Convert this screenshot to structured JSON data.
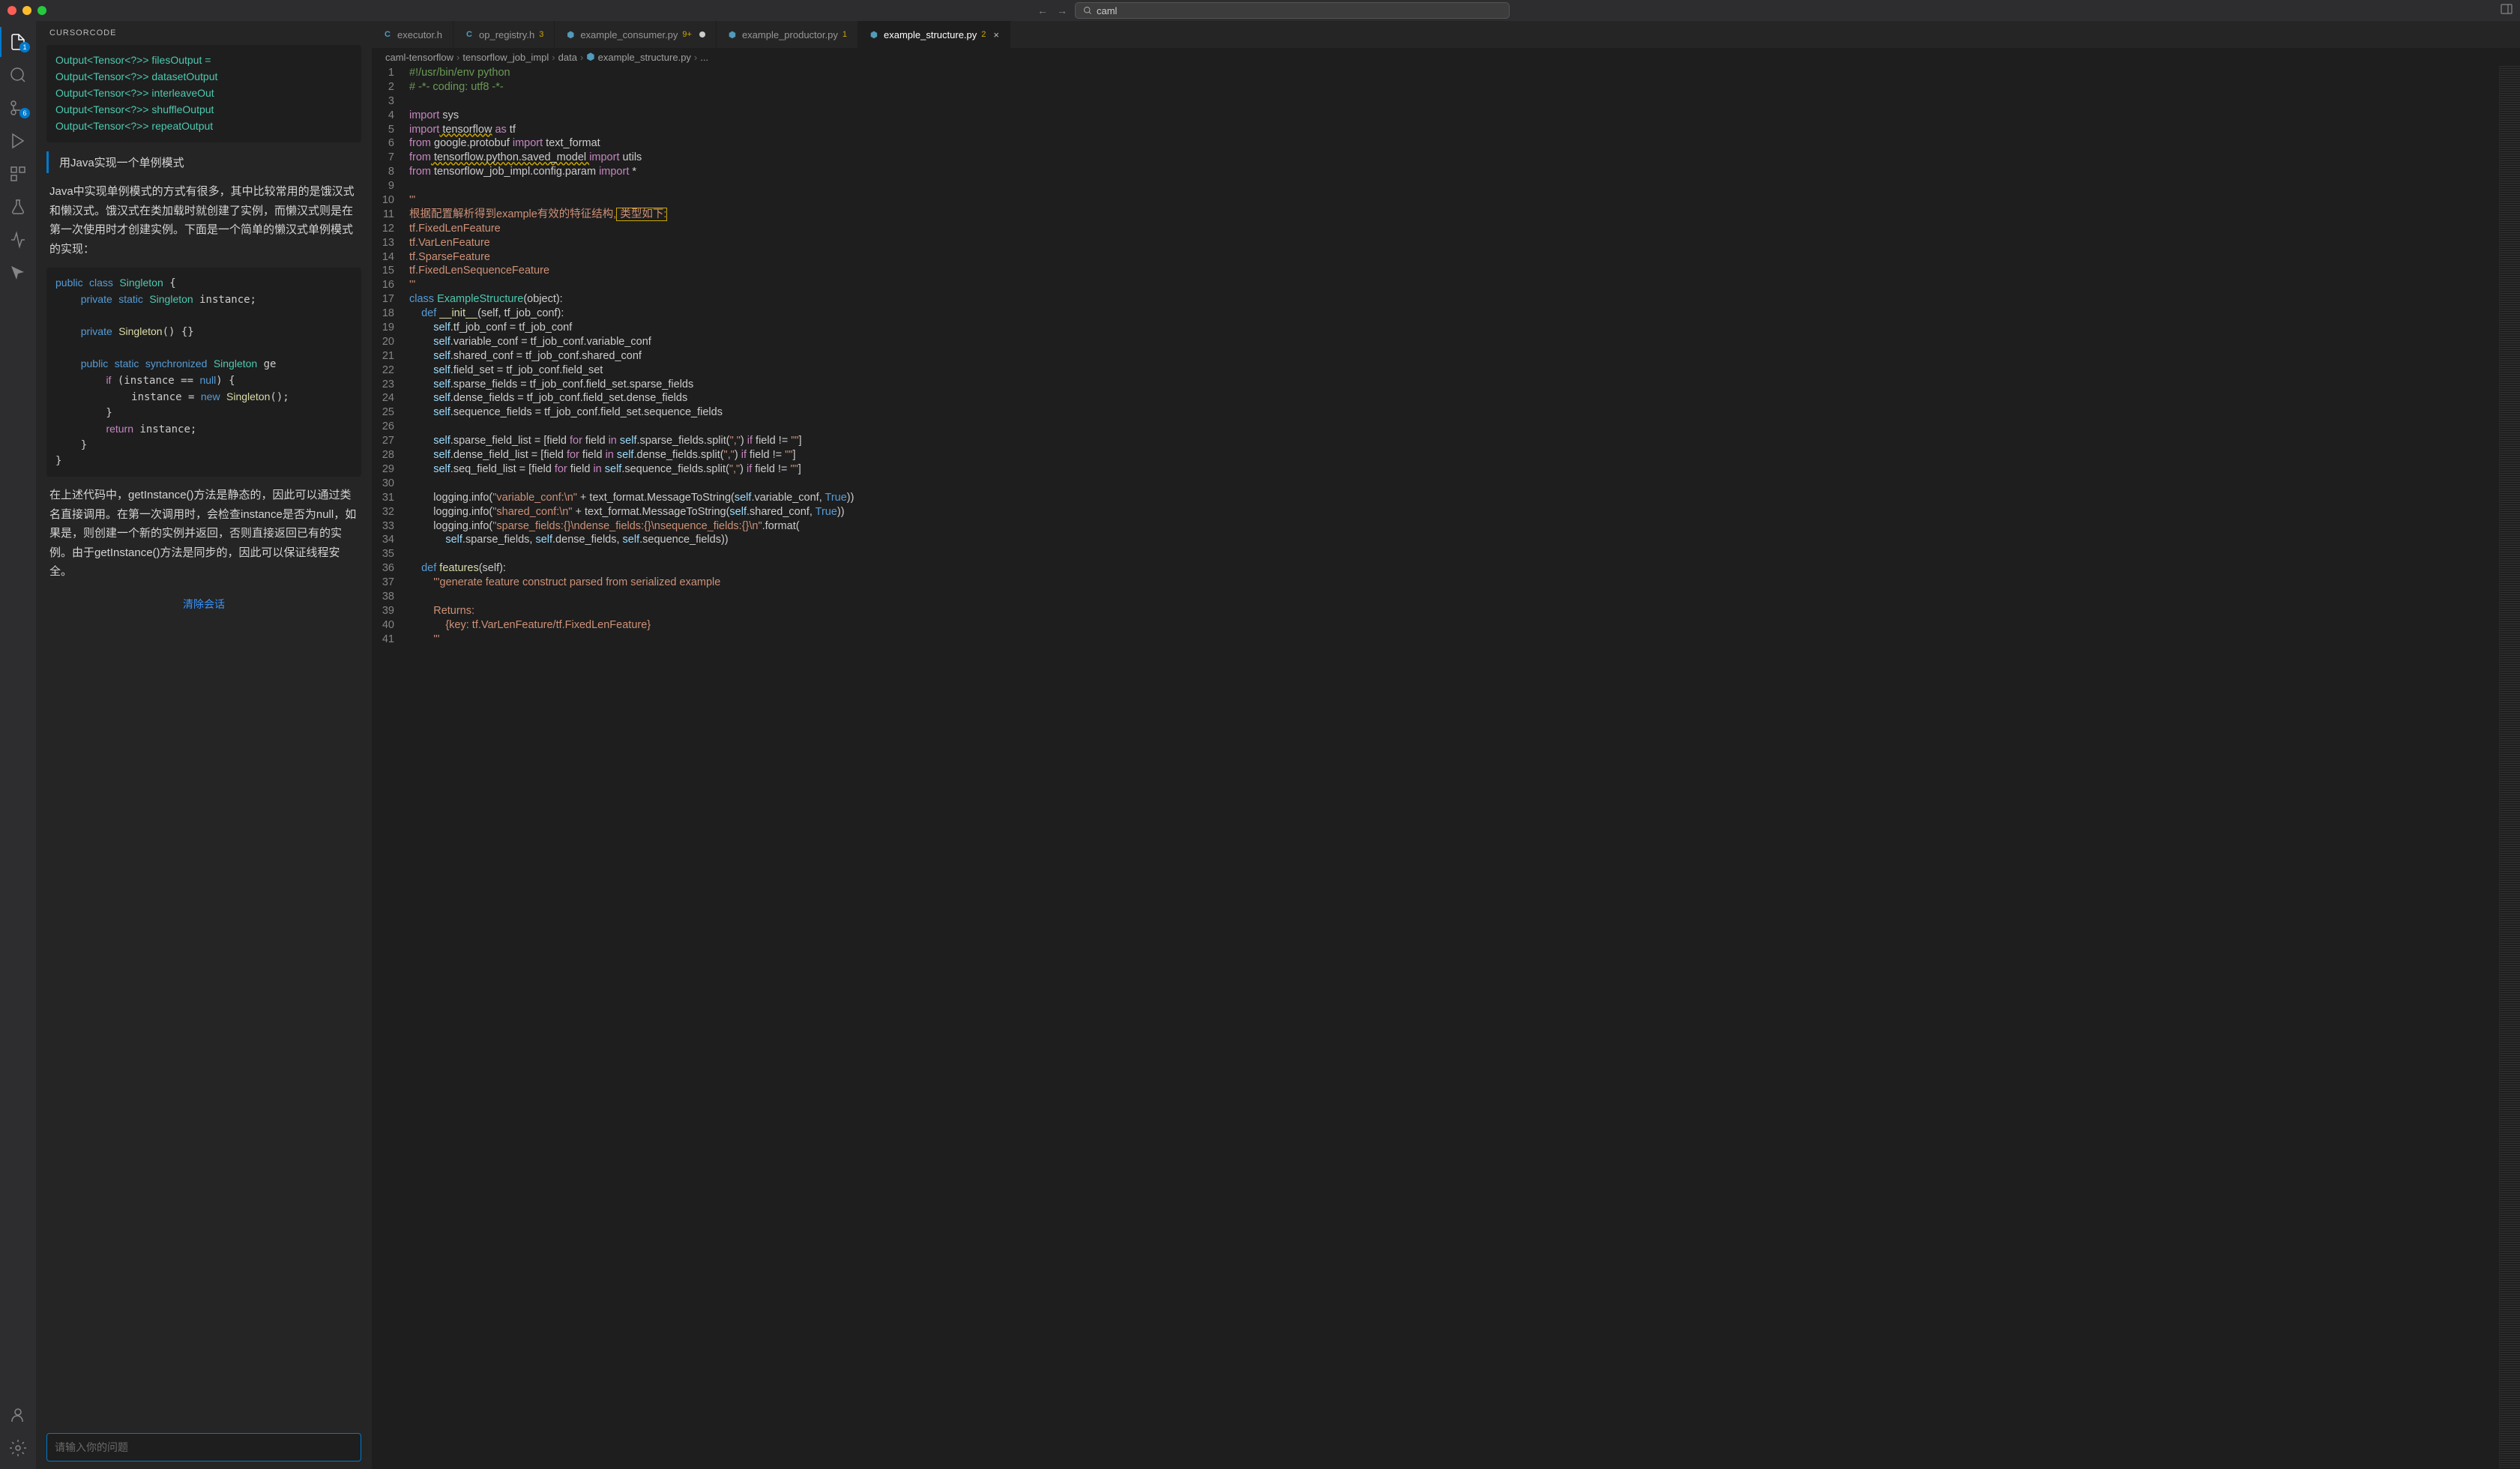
{
  "search": {
    "text": "caml"
  },
  "sidebar": {
    "header": "CURSORCODE",
    "badges": {
      "explorer": "1",
      "scm": "6"
    },
    "code1": "Output<Tensor<?>> filesOutput =\nOutput<Tensor<?>> datasetOutput\nOutput<Tensor<?>> interleaveOut\nOutput<Tensor<?>> shuffleOutput\nOutput<Tensor<?>> repeatOutput",
    "user_msg": "用Java实现一个单例模式",
    "reply1": "Java中实现单例模式的方式有很多，其中比较常用的是饿汉式和懒汉式。饿汉式在类加载时就创建了实例，而懒汉式则是在第一次使用时才创建实例。下面是一个简单的懒汉式单例模式的实现：",
    "reply2": "在上述代码中，getInstance()方法是静态的，因此可以通过类名直接调用。在第一次调用时，会检查instance是否为null，如果是，则创建一个新的实例并返回，否则直接返回已有的实例。由于getInstance()方法是同步的，因此可以保证线程安全。",
    "clear": "清除会话",
    "input_placeholder": "请输入你的问题"
  },
  "tabs": [
    {
      "icon": "C",
      "label": "executor.h",
      "badge": "",
      "active": false,
      "modified": false
    },
    {
      "icon": "C",
      "label": "op_registry.h",
      "badge": "3",
      "active": false,
      "modified": false
    },
    {
      "icon": "py",
      "label": "example_consumer.py",
      "badge": "9+",
      "active": false,
      "modified": true
    },
    {
      "icon": "py",
      "label": "example_productor.py",
      "badge": "1",
      "active": false,
      "modified": false
    },
    {
      "icon": "py",
      "label": "example_structure.py",
      "badge": "2",
      "active": true,
      "modified": false
    }
  ],
  "breadcrumb": [
    "caml-tensorflow",
    "tensorflow_job_impl",
    "data",
    "example_structure.py",
    "..."
  ],
  "java_code": {
    "l1": "public class Singleton {",
    "l2": "    private static Singleton instance;",
    "l3": "",
    "l4": "    private Singleton() {}",
    "l5": "",
    "l6": "    public static synchronized Singleton ge",
    "l7": "        if (instance == null) {",
    "l8": "            instance = new Singleton();",
    "l9": "        }",
    "l10": "        return instance;",
    "l11": "    }",
    "l12": "}"
  },
  "code": {
    "l1_a": "#!/usr/bin/env python",
    "l2_a": "# -*- coding: utf8 -*-",
    "l4_import": "import",
    "l4_sys": " sys",
    "l5_import": "import",
    "l5_tf": " tensorflow",
    "l5_as": " as",
    "l5_tfalias": " tf",
    "l6_from": "from",
    "l6_mod": " google.protobuf ",
    "l6_import": "import",
    "l6_name": " text_format",
    "l7_from": "from",
    "l7_mod": " tensorflow.python.saved_model ",
    "l7_import": "import",
    "l7_name": " utils",
    "l8_from": "from",
    "l8_mod": " tensorflow_job_impl.config.param ",
    "l8_import": "import",
    "l8_name": " *",
    "l10": "'''",
    "l11_a": "根据配置解析得到example有效的特征结构,",
    "l11_b": " 类型如下:",
    "l12": "tf.FixedLenFeature",
    "l13": "tf.VarLenFeature",
    "l14": "tf.SparseFeature",
    "l15": "tf.FixedLenSequenceFeature",
    "l16": "'''",
    "l17_class": "class",
    "l17_name": " ExampleStructure",
    "l17_rest": "(object):",
    "l18_def": "    def",
    "l18_name": " __init__",
    "l18_rest": "(self, tf_job_conf):",
    "l19_a": "        self",
    "l19_b": ".tf_job_conf = tf_job_conf",
    "l20_a": "        self",
    "l20_b": ".variable_conf = tf_job_conf.variable_conf",
    "l21_a": "        self",
    "l21_b": ".shared_conf = tf_job_conf.shared_conf",
    "l22_a": "        self",
    "l22_b": ".field_set = tf_job_conf.field_set",
    "l23_a": "        self",
    "l23_b": ".sparse_fields = tf_job_conf.field_set.sparse_fields",
    "l24_a": "        self",
    "l24_b": ".dense_fields = tf_job_conf.field_set.dense_fields",
    "l25_a": "        self",
    "l25_b": ".sequence_fields = tf_job_conf.field_set.sequence_fields",
    "l27_a": "        self",
    "l27_b": ".sparse_field_list = [field ",
    "l27_for": "for",
    "l27_c": " field ",
    "l27_in": "in",
    "l27_d": " self",
    "l27_e": ".sparse_fields.split(",
    "l27_str": "\",\"",
    "l27_f": ") ",
    "l27_if": "if",
    "l27_g": " field != ",
    "l27_str2": "\"\"",
    "l27_h": "]",
    "l28_a": "        self",
    "l28_b": ".dense_field_list = [field ",
    "l28_for": "for",
    "l28_c": " field ",
    "l28_in": "in",
    "l28_d": " self",
    "l28_e": ".dense_fields.split(",
    "l28_str": "\",\"",
    "l28_f": ") ",
    "l28_if": "if",
    "l28_g": " field != ",
    "l28_str2": "\"\"",
    "l28_h": "]",
    "l29_a": "        self",
    "l29_b": ".seq_field_list = [field ",
    "l29_for": "for",
    "l29_c": " field ",
    "l29_in": "in",
    "l29_d": " self",
    "l29_e": ".sequence_fields.split(",
    "l29_str": "\",\"",
    "l29_f": ") ",
    "l29_if": "if",
    "l29_g": " field != ",
    "l29_str2": "\"\"",
    "l29_h": "]",
    "l31_a": "        logging.info(",
    "l31_str": "\"variable_conf:\\n\"",
    "l31_b": " + text_format.MessageToString(",
    "l31_self": "self",
    "l31_c": ".variable_conf, ",
    "l31_true": "True",
    "l31_d": "))",
    "l32_a": "        logging.info(",
    "l32_str": "\"shared_conf:\\n\"",
    "l32_b": " + text_format.MessageToString(",
    "l32_self": "self",
    "l32_c": ".shared_conf, ",
    "l32_true": "True",
    "l32_d": "))",
    "l33_a": "        logging.info(",
    "l33_str": "\"sparse_fields:{}\\ndense_fields:{}\\nsequence_fields:{}\\n\"",
    "l33_b": ".format(",
    "l34_a": "            self",
    "l34_b": ".sparse_fields, ",
    "l34_c": "self",
    "l34_d": ".dense_fields, ",
    "l34_e": "self",
    "l34_f": ".sequence_fields))",
    "l36_def": "    def",
    "l36_name": " features",
    "l36_rest": "(self):",
    "l37": "        '''generate feature construct parsed from serialized example",
    "l39": "        Returns:",
    "l40": "            {key: tf.VarLenFeature/tf.FixedLenFeature}",
    "l41": "        '''"
  }
}
